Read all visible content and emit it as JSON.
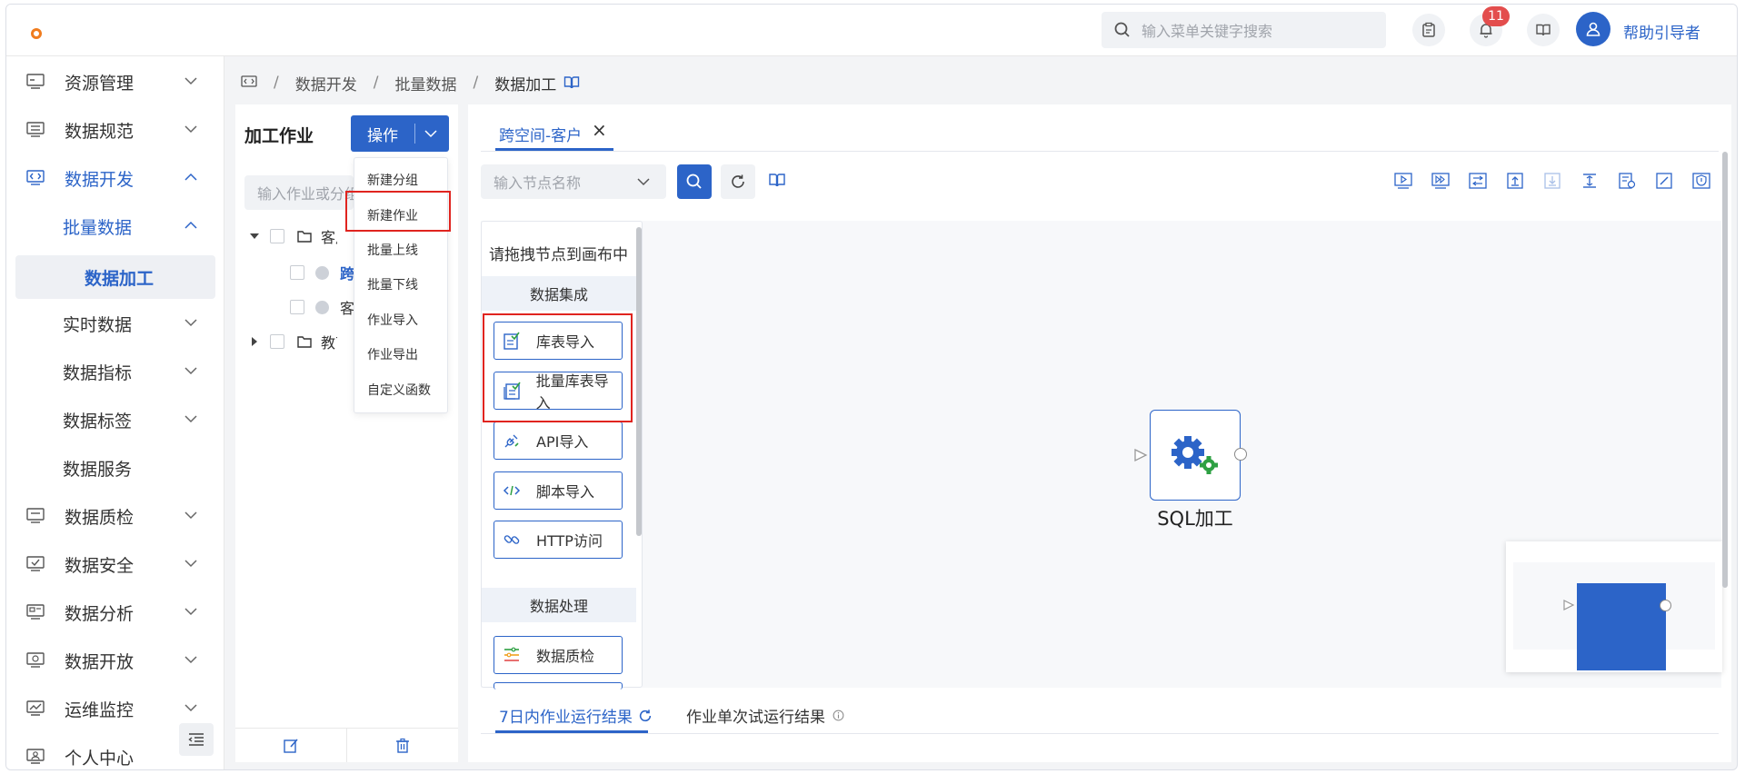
{
  "topbar": {
    "search_placeholder": "输入菜单关键字搜索",
    "notification_count": "11",
    "username": "帮助引导者"
  },
  "sidebar": {
    "items": [
      {
        "label": "资源管理",
        "icon": "server-icon"
      },
      {
        "label": "数据规范",
        "icon": "database-icon"
      },
      {
        "label": "数据开发",
        "icon": "code-icon"
      },
      {
        "label": "批量数据"
      },
      {
        "label": "数据加工"
      },
      {
        "label": "实时数据"
      },
      {
        "label": "数据指标"
      },
      {
        "label": "数据标签"
      },
      {
        "label": "数据服务"
      },
      {
        "label": "数据质检",
        "icon": "monitor-icon"
      },
      {
        "label": "数据安全",
        "icon": "shield-check-icon"
      },
      {
        "label": "数据分析",
        "icon": "chart-screen-icon"
      },
      {
        "label": "数据开放",
        "icon": "share-screen-icon"
      },
      {
        "label": "运维监控",
        "icon": "line-chart-icon"
      },
      {
        "label": "个人中心",
        "icon": "user-card-icon"
      }
    ]
  },
  "breadcrumb": {
    "items": [
      "数据开发",
      "批量数据",
      "数据加工"
    ]
  },
  "job_panel": {
    "title": "加工作业",
    "operate_label": "操作",
    "search_placeholder": "输入作业或分组",
    "tree": [
      {
        "label": "客户"
      },
      {
        "label": "跨空间-客户"
      },
      {
        "label": "客户"
      },
      {
        "label": "教育"
      }
    ]
  },
  "operate_menu": {
    "items": [
      "新建分组",
      "新建作业",
      "批量上线",
      "批量下线",
      "作业导入",
      "作业导出",
      "自定义函数"
    ]
  },
  "workspace": {
    "active_tab": "跨空间-客户",
    "node_placeholder": "输入节点名称",
    "palette": {
      "hint": "请拖拽节点到画布中",
      "section1": "数据集成",
      "buttons1": [
        "库表导入",
        "批量库表导入",
        "API导入",
        "脚本导入",
        "HTTP访问"
      ],
      "section2": "数据处理",
      "buttons2": [
        "数据质检"
      ]
    },
    "node_label": "SQL加工",
    "bottom_tabs": [
      "7日内作业运行结果",
      "作业单次试运行结果"
    ]
  },
  "colors": {
    "accent": "#2c64c8",
    "highlight": "#e0241f",
    "badge": "#e34d4d"
  }
}
